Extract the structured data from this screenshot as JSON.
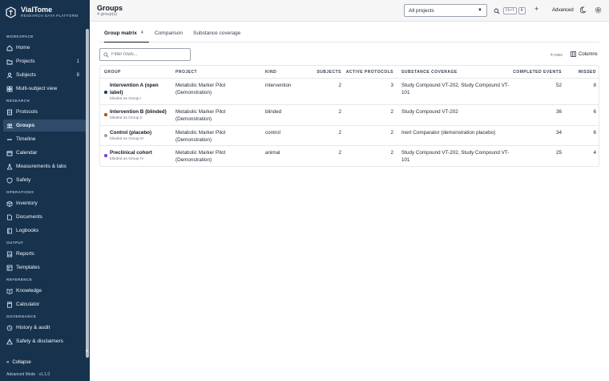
{
  "app": {
    "name": "VialTome",
    "tagline": "RESEARCH DATA PLATFORM",
    "collapse_label": "Collapse",
    "mode_label": "Advanced Mode · v1.1.0"
  },
  "sidebar": {
    "sections": [
      {
        "label": "WORKSPACE",
        "items": [
          {
            "label": "Home",
            "icon": "home-icon"
          },
          {
            "label": "Projects",
            "icon": "folder-icon",
            "count": "1"
          },
          {
            "label": "Subjects",
            "icon": "person-icon",
            "count": "8"
          },
          {
            "label": "Multi-subject view",
            "icon": "grid-icon"
          }
        ]
      },
      {
        "label": "RESEARCH",
        "items": [
          {
            "label": "Protocols",
            "icon": "document-icon"
          },
          {
            "label": "Groups",
            "icon": "group-icon",
            "active": true
          },
          {
            "label": "Timeline",
            "icon": "timeline-icon"
          },
          {
            "label": "Calendar",
            "icon": "calendar-icon"
          },
          {
            "label": "Measurements & labs",
            "icon": "flask-icon"
          },
          {
            "label": "Safety",
            "icon": "shield-icon"
          }
        ]
      },
      {
        "label": "OPERATIONS",
        "items": [
          {
            "label": "Inventory",
            "icon": "box-icon"
          },
          {
            "label": "Documents",
            "icon": "file-icon"
          },
          {
            "label": "Logbooks",
            "icon": "book-icon"
          }
        ]
      },
      {
        "label": "OUTPUT",
        "items": [
          {
            "label": "Reports",
            "icon": "report-icon"
          },
          {
            "label": "Templates",
            "icon": "template-icon"
          }
        ]
      },
      {
        "label": "REFERENCE",
        "items": [
          {
            "label": "Knowledge",
            "icon": "knowledge-icon"
          },
          {
            "label": "Calculator",
            "icon": "calculator-icon"
          }
        ]
      },
      {
        "label": "GOVERNANCE",
        "items": [
          {
            "label": "History & audit",
            "icon": "history-icon"
          },
          {
            "label": "Safety & disclaimers",
            "icon": "warning-icon"
          }
        ]
      }
    ]
  },
  "header": {
    "title": "Groups",
    "subtitle": "4 group(s)",
    "project_select": "All projects",
    "kbd_ctrl": "Ctrl",
    "kbd_k": "K",
    "advanced_label": "Advanced"
  },
  "tabs": [
    {
      "label": "Group matrix",
      "badge": "4",
      "active": true
    },
    {
      "label": "Comparison"
    },
    {
      "label": "Substance coverage"
    }
  ],
  "toolbar": {
    "filter_placeholder": "Filter rows...",
    "row_count": "4 rows",
    "columns_label": "Columns"
  },
  "table": {
    "headers": {
      "group": "GROUP",
      "project": "PROJECT",
      "kind": "KIND",
      "subjects": "SUBJECTS",
      "active_protocols": "ACTIVE PROTOCOLS",
      "substance": "SUBSTANCE COVERAGE",
      "completed": "COMPLETED EVENTS",
      "missed": "MISSED"
    },
    "rows": [
      {
        "dot_color": "#1e3a5f",
        "name": "Intervention A (open label)",
        "blinded": "blinded as Group I",
        "project": "Metabolic Marker Pilot (Demonstration)",
        "kind": "intervention",
        "subjects": "2",
        "protocols": "3",
        "substance": "Study Compound VT-202, Study Compound VT-101",
        "completed": "52",
        "missed": "8"
      },
      {
        "dot_color": "#b45309",
        "name": "Intervention B (blinded)",
        "blinded": "blinded as Group II",
        "project": "Metabolic Marker Pilot (Demonstration)",
        "kind": "blinded",
        "subjects": "2",
        "protocols": "2",
        "substance": "Study Compound VT-202",
        "completed": "36",
        "missed": "6"
      },
      {
        "dot_color": "#9ca3af",
        "name": "Control (placebo)",
        "blinded": "blinded as Group III",
        "project": "Metabolic Marker Pilot (Demonstration)",
        "kind": "control",
        "subjects": "2",
        "protocols": "2",
        "substance": "Inert Comparator (demonstration placebo)",
        "completed": "34",
        "missed": "6"
      },
      {
        "dot_color": "#7c3aed",
        "name": "Preclinical cohort",
        "blinded": "blinded as Group IV",
        "project": "Metabolic Marker Pilot (Demonstration)",
        "kind": "animal",
        "subjects": "2",
        "protocols": "2",
        "substance": "Study Compound VT-202, Study Compound VT-101",
        "completed": "25",
        "missed": "4"
      }
    ]
  }
}
